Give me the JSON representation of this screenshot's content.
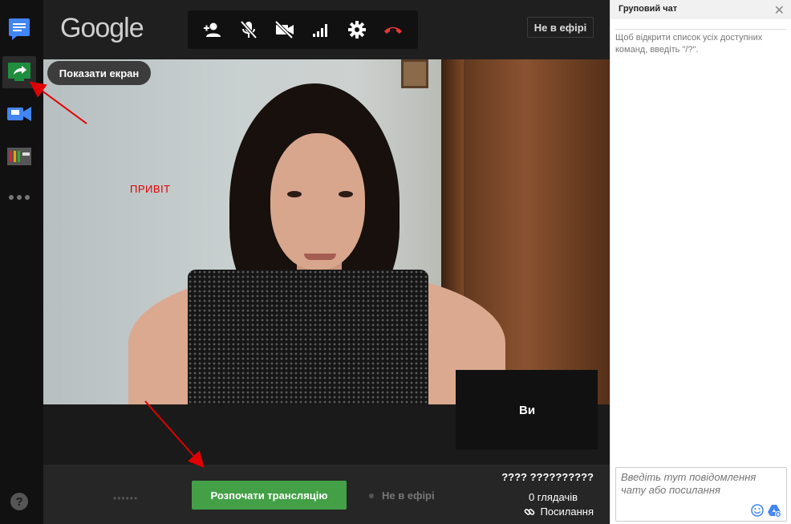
{
  "rail": {
    "items": [
      {
        "name": "chat",
        "color": "#4285f4"
      },
      {
        "name": "screenshare",
        "color": "#1e8e3e"
      },
      {
        "name": "cameraman",
        "color": "#4285f4"
      },
      {
        "name": "control-room",
        "color": "#e0a800"
      },
      {
        "name": "more",
        "color": "#777777"
      }
    ],
    "help_label": "?"
  },
  "header": {
    "logo": "Google",
    "on_air_badge": "Не в ефірі"
  },
  "tooltip": "Показати екран",
  "video": {
    "overlay_text": "ПРИВІТ",
    "self_view_label": "Ви"
  },
  "bottom": {
    "dots": "••••••",
    "start_button": "Розпочати трансляцію",
    "status": "Не в ефірі",
    "event_title": "???? ??????????",
    "viewers": "0 глядачів",
    "link_label": "Посилання"
  },
  "chat": {
    "title": "Груповий чат",
    "close": "✕",
    "hint": "Щоб відкрити список усіх доступних команд, введіть \"/?\".",
    "input_placeholder": "Введіть тут повідомлення чату або посилання"
  },
  "colors": {
    "accent_green": "#43a047",
    "annotation_red": "#e00000",
    "hangup_red": "#e53935"
  }
}
